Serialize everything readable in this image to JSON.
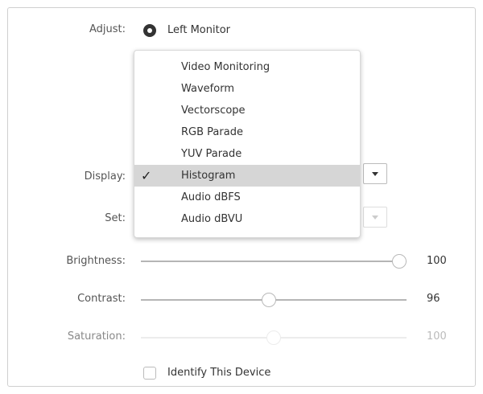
{
  "adjust": {
    "label": "Adjust:",
    "selected_option": "Left Monitor"
  },
  "display": {
    "label": "Display:",
    "options": [
      {
        "label": "Video Monitoring",
        "selected": false
      },
      {
        "label": "Waveform",
        "selected": false
      },
      {
        "label": "Vectorscope",
        "selected": false
      },
      {
        "label": "RGB Parade",
        "selected": false
      },
      {
        "label": "YUV Parade",
        "selected": false
      },
      {
        "label": "Histogram",
        "selected": true
      },
      {
        "label": "Audio dBFS",
        "selected": false
      },
      {
        "label": "Audio dBVU",
        "selected": false
      }
    ],
    "check_mark": "✓"
  },
  "set": {
    "label": "Set:"
  },
  "sliders": {
    "brightness": {
      "label": "Brightness:",
      "value": "100",
      "fraction": 1.0,
      "enabled": true
    },
    "contrast": {
      "label": "Contrast:",
      "value": "96",
      "fraction": 0.48,
      "enabled": true
    },
    "saturation": {
      "label": "Saturation:",
      "value": "100",
      "fraction": 0.5,
      "enabled": false
    }
  },
  "identify": {
    "label": "Identify This Device",
    "checked": false
  },
  "icons": {
    "radio": "radio-selected-icon",
    "dropdown_arrow": "chevron-down-icon",
    "check": "checkmark-icon"
  }
}
